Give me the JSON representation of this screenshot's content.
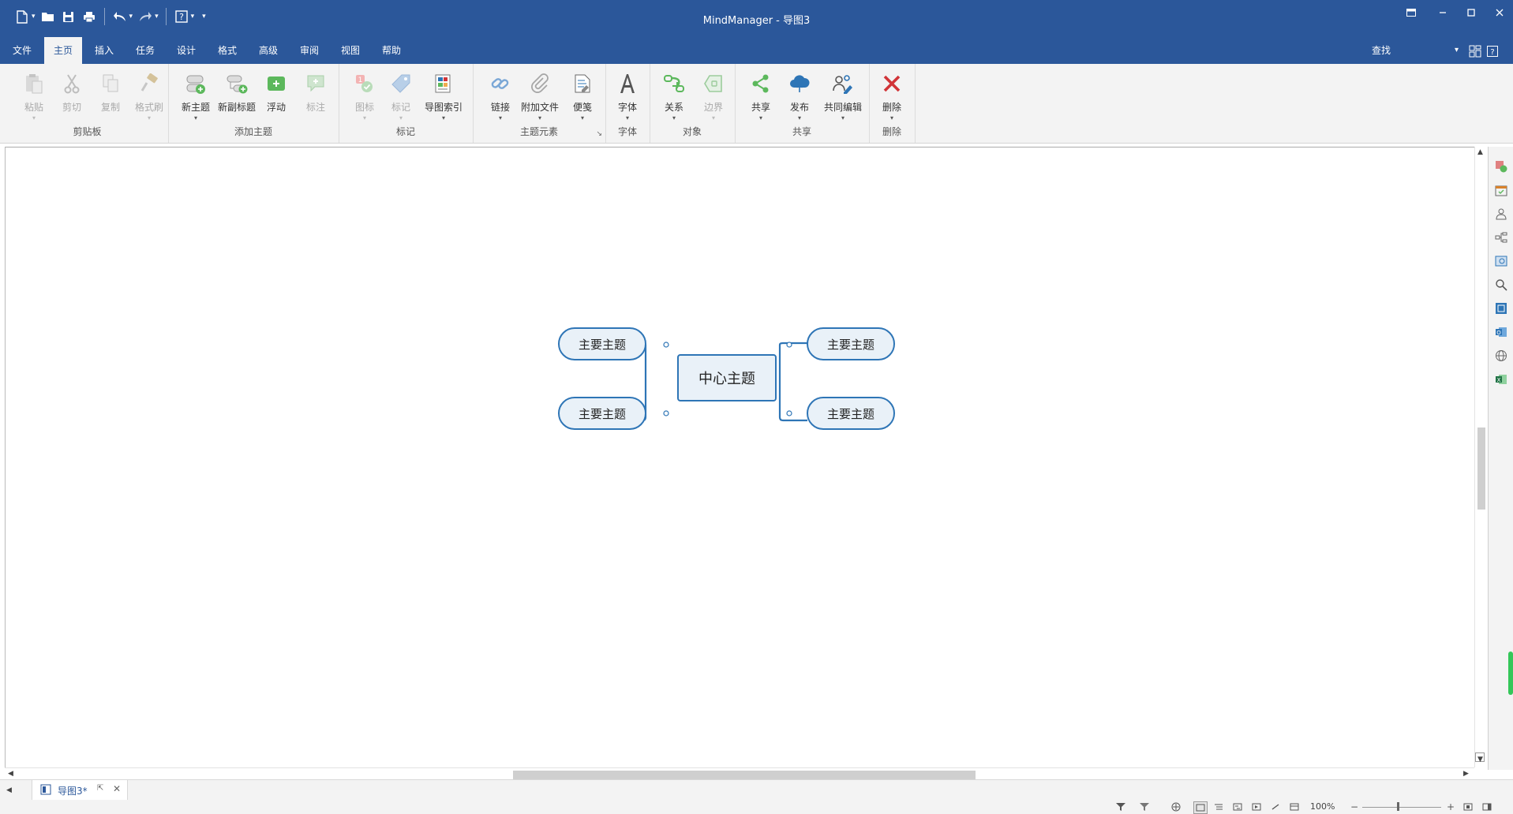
{
  "app": {
    "title": "MindManager - 导图3"
  },
  "quick_access": {
    "icons": [
      "new-file-icon",
      "open-folder-icon",
      "save-icon",
      "print-icon",
      "undo-icon",
      "redo-icon",
      "help-icon",
      "customize-icon"
    ]
  },
  "menu": {
    "items": [
      {
        "label": "文件"
      },
      {
        "label": "主页"
      },
      {
        "label": "插入"
      },
      {
        "label": "任务"
      },
      {
        "label": "设计"
      },
      {
        "label": "格式"
      },
      {
        "label": "高级"
      },
      {
        "label": "审阅"
      },
      {
        "label": "视图"
      },
      {
        "label": "帮助"
      }
    ],
    "active_index": 1,
    "search_label": "查找"
  },
  "ribbon": {
    "groups": [
      {
        "title": "剪贴板",
        "buttons": [
          {
            "label": "粘贴",
            "icon": "paste-icon"
          },
          {
            "label": "剪切",
            "icon": "cut-icon"
          },
          {
            "label": "复制",
            "icon": "copy-icon"
          },
          {
            "label": "格式刷",
            "icon": "format-painter-icon"
          }
        ]
      },
      {
        "title": "添加主题",
        "buttons": [
          {
            "label": "新主题",
            "icon": "new-topic-icon"
          },
          {
            "label": "新副标题",
            "icon": "new-subtopic-icon"
          },
          {
            "label": "浮动",
            "icon": "floating-topic-icon"
          },
          {
            "label": "标注",
            "icon": "callout-icon"
          }
        ]
      },
      {
        "title": "标记",
        "buttons": [
          {
            "label": "图标",
            "icon": "icon-marker-icon"
          },
          {
            "label": "标记",
            "icon": "tag-icon"
          },
          {
            "label": "导图索引",
            "icon": "map-index-icon"
          }
        ]
      },
      {
        "title": "主题元素",
        "buttons": [
          {
            "label": "链接",
            "icon": "link-icon"
          },
          {
            "label": "附加文件",
            "icon": "attachment-icon"
          },
          {
            "label": "便笺",
            "icon": "notes-icon"
          }
        ]
      },
      {
        "title": "字体",
        "buttons": [
          {
            "label": "字体",
            "icon": "font-icon"
          }
        ]
      },
      {
        "title": "对象",
        "buttons": [
          {
            "label": "关系",
            "icon": "relationship-icon"
          },
          {
            "label": "边界",
            "icon": "boundary-icon"
          }
        ]
      },
      {
        "title": "共享",
        "buttons": [
          {
            "label": "共享",
            "icon": "share-icon"
          },
          {
            "label": "发布",
            "icon": "publish-icon"
          },
          {
            "label": "共同编辑",
            "icon": "co-edit-icon"
          }
        ]
      },
      {
        "title": "删除",
        "buttons": [
          {
            "label": "删除",
            "icon": "delete-icon"
          }
        ]
      }
    ]
  },
  "mindmap": {
    "central": {
      "label": "中心主题"
    },
    "topics": [
      {
        "label": "主要主题"
      },
      {
        "label": "主要主题"
      },
      {
        "label": "主要主题"
      },
      {
        "label": "主要主题"
      }
    ],
    "border_color": "#2e75b6",
    "fill_color": "#e9f1f8"
  },
  "tabs": [
    {
      "label": "导图3*"
    }
  ],
  "statusbar": {
    "zoom": "100%"
  },
  "colors": {
    "titlebar": "#2b579a",
    "ribbon_bg": "#f3f3f3",
    "delete_red": "#d13438",
    "green": "#5cb85c"
  }
}
